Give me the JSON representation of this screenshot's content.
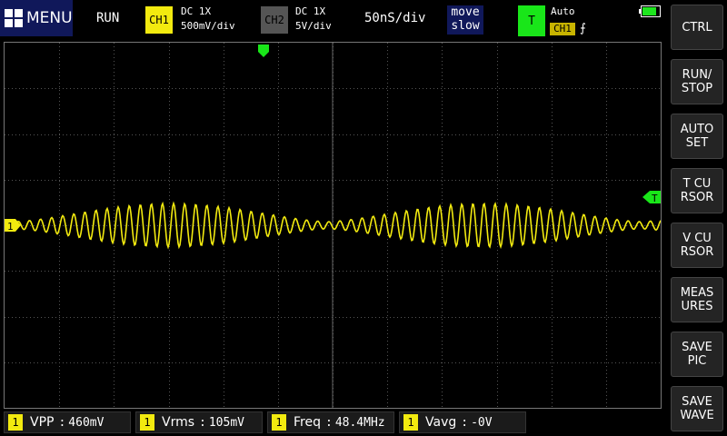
{
  "header": {
    "menu_label": "MENU",
    "run_state": "RUN",
    "ch1": {
      "badge": "CH1",
      "coupling": "DC  1X",
      "scale": "500mV/div"
    },
    "ch2": {
      "badge": "CH2",
      "coupling": "DC  1X",
      "scale": "5V/div"
    },
    "timebase": "50nS/div",
    "move_line1": "move",
    "move_line2": "slow",
    "trigger": {
      "badge": "T",
      "mode": "Auto",
      "source": "CH1",
      "edge": "⨍"
    },
    "battery_level": 0.85
  },
  "screen": {
    "ch1_marker": "1",
    "trigger_marker": "T",
    "trace_color": "#f2ea0f",
    "trigger_color": "#19e619"
  },
  "sidebar": {
    "buttons": [
      {
        "label": "CTRL"
      },
      {
        "label": "RUN/\nSTOP"
      },
      {
        "label": "AUTO\nSET"
      },
      {
        "label": "T CU\nRSOR"
      },
      {
        "label": "V CU\nRSOR"
      },
      {
        "label": "MEAS\nURES"
      },
      {
        "label": "SAVE\nPIC"
      },
      {
        "label": "SAVE\nWAVE"
      }
    ]
  },
  "measurements": [
    {
      "channel": "1",
      "label": "VPP",
      "value": "460mV"
    },
    {
      "channel": "1",
      "label": "Vrms",
      "value": "105mV"
    },
    {
      "channel": "1",
      "label": "Freq",
      "value": "48.4MHz"
    },
    {
      "channel": "1",
      "label": "Vavg",
      "value": "-0V"
    }
  ]
}
